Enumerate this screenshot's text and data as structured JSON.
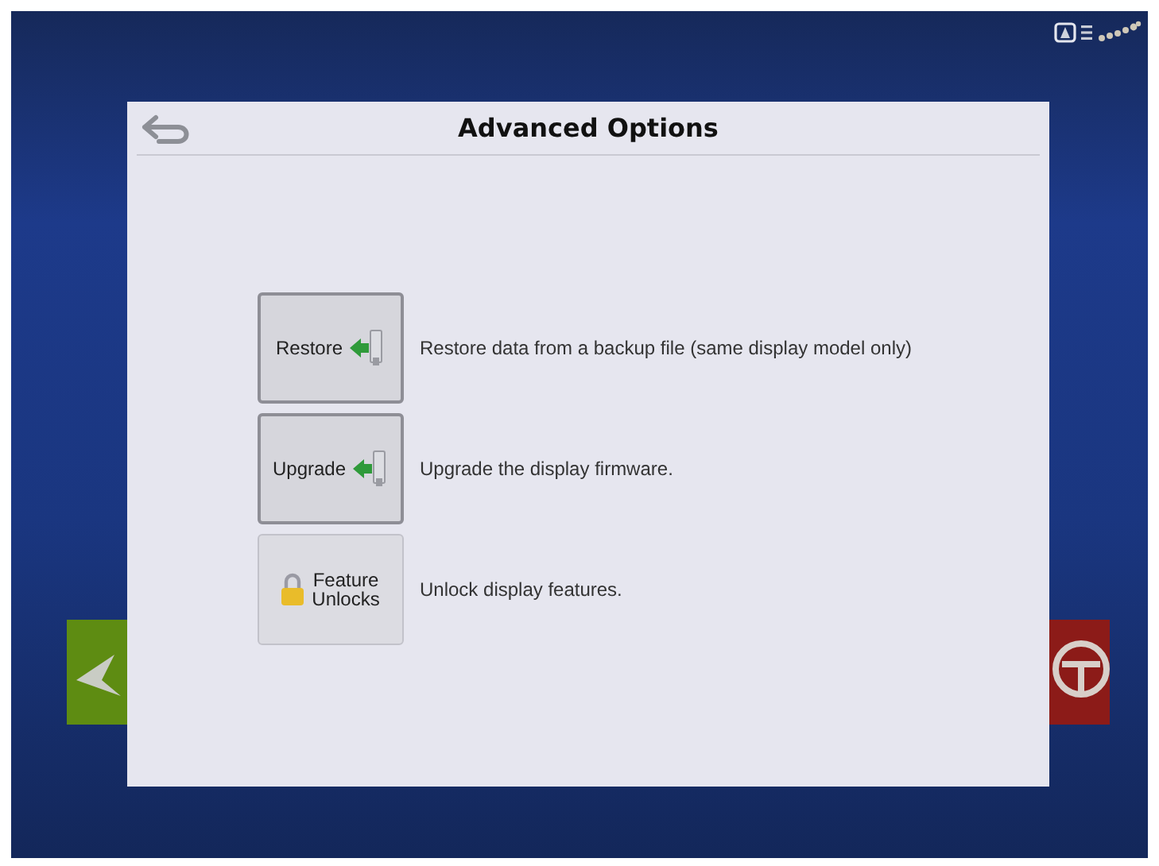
{
  "dialog": {
    "title": "Advanced Options"
  },
  "options": [
    {
      "kind": "restore",
      "label": "Restore",
      "description": "Restore data from a backup file (same display model only)"
    },
    {
      "kind": "upgrade",
      "label": "Upgrade",
      "description": "Upgrade the display firmware."
    },
    {
      "kind": "unlock",
      "label": "Feature Unlocks",
      "description": "Unlock display features."
    }
  ]
}
